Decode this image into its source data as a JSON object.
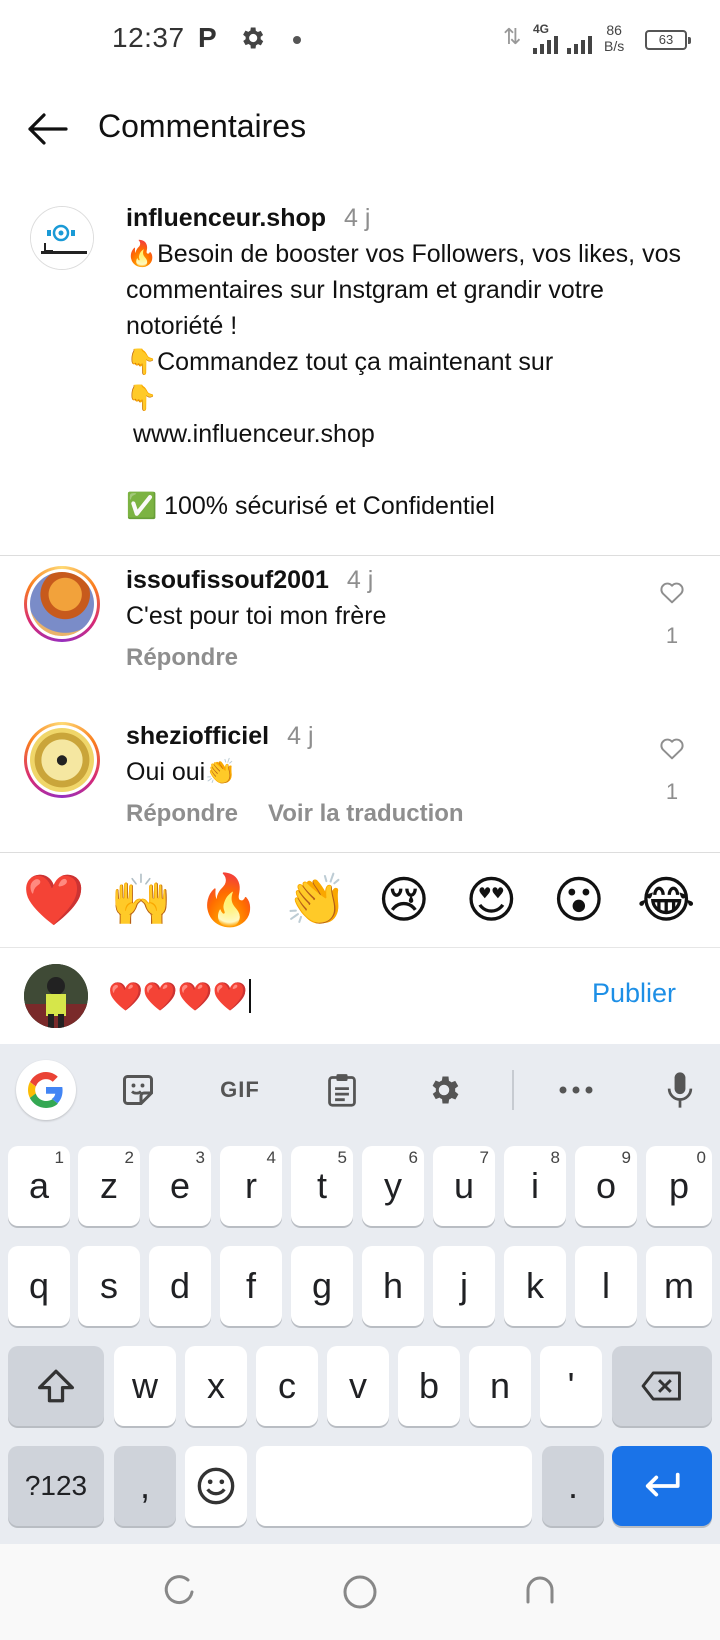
{
  "status_bar": {
    "time": "12:37",
    "p_icon": "P",
    "network": "4G",
    "speed_value": "86",
    "speed_unit": "B/s",
    "battery": "63"
  },
  "header": {
    "title": "Commentaires"
  },
  "post": {
    "username": "influenceur.shop",
    "time": "4 j",
    "lines": [
      "🔥Besoin de booster vos Followers, vos likes, vos commentaires sur Instgram et grandir votre notoriété !",
      "👇Commandez tout ça maintenant sur👇",
      " www.influenceur.shop",
      "",
      "✅ 100% sécurisé et Confidentiel"
    ]
  },
  "comments": [
    {
      "username": "issoufissouf2001",
      "time": "4 j",
      "text": "C'est pour toi mon frère",
      "reply": "Répondre",
      "likes": "1"
    },
    {
      "username": "sheziofficiel",
      "time": "4 j",
      "text": "Oui oui👏",
      "reply": "Répondre",
      "translate": "Voir la traduction",
      "likes": "1"
    }
  ],
  "emoji_bar": [
    "❤️",
    "🙌",
    "🔥",
    "👏",
    "😢",
    "😍",
    "😮",
    "😂"
  ],
  "composer": {
    "value": "❤️❤️❤️❤️",
    "publish": "Publier"
  },
  "keyboard": {
    "row1": [
      {
        "k": "a",
        "n": "1"
      },
      {
        "k": "z",
        "n": "2"
      },
      {
        "k": "e",
        "n": "3"
      },
      {
        "k": "r",
        "n": "4"
      },
      {
        "k": "t",
        "n": "5"
      },
      {
        "k": "y",
        "n": "6"
      },
      {
        "k": "u",
        "n": "7"
      },
      {
        "k": "i",
        "n": "8"
      },
      {
        "k": "o",
        "n": "9"
      },
      {
        "k": "p",
        "n": "0"
      }
    ],
    "row2": [
      "q",
      "s",
      "d",
      "f",
      "g",
      "h",
      "j",
      "k",
      "l",
      "m"
    ],
    "row3": [
      "w",
      "x",
      "c",
      "v",
      "b",
      "n",
      "'"
    ],
    "symbols": "?123",
    "comma": ",",
    "period": ".",
    "gif": "GIF"
  },
  "colors": {
    "accent": "#1d8fe6",
    "keyboard_bg": "#e9ecf1",
    "enter_key": "#1a73e8"
  }
}
